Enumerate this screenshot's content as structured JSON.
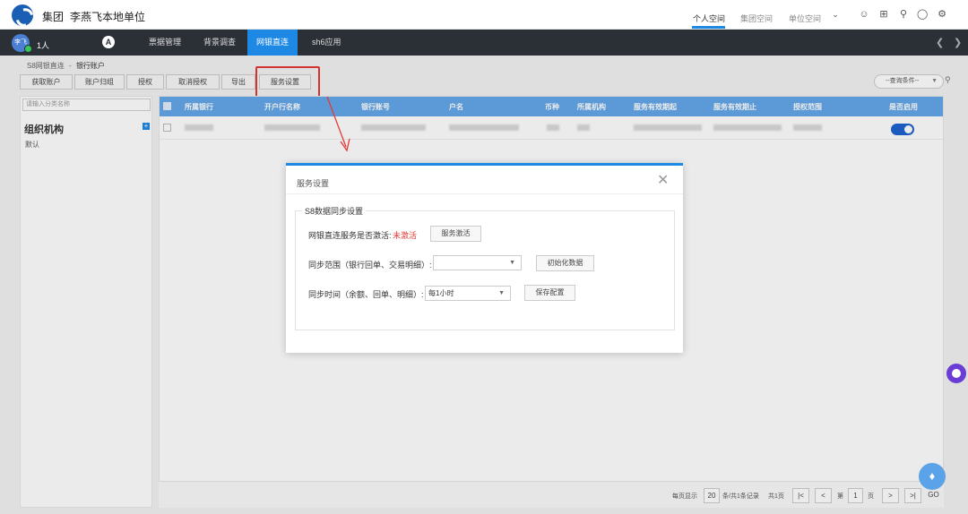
{
  "header": {
    "org": "集团",
    "unit": "李燕飞本地单位",
    "tabs": [
      "个人空间",
      "集团空间",
      "单位空间"
    ],
    "icons": [
      "user-icon",
      "apps-icon",
      "search-icon",
      "chat-icon",
      "settings-icon"
    ]
  },
  "nav": {
    "avatar_text": "李飞",
    "user_count": "1人",
    "items": [
      "票据管理",
      "背景调查",
      "网银直连",
      "sh6应用"
    ],
    "active_index": 2
  },
  "breadcrumb": {
    "parent": "S8网银直连",
    "separator": "-",
    "current": "银行账户"
  },
  "toolbar": {
    "buttons": [
      "获取账户",
      "账户归组",
      "授权",
      "取消授权",
      "导出",
      "服务设置"
    ],
    "query_placeholder": "--查询条件--"
  },
  "left_panel": {
    "search_placeholder": "请输入分类名称",
    "title": "组织机构",
    "items": [
      "默认"
    ]
  },
  "table": {
    "headers": [
      "所属银行",
      "开户行名称",
      "银行账号",
      "户名",
      "币种",
      "所属机构",
      "服务有效期起",
      "服务有效期止",
      "授权范围",
      "是否启用"
    ]
  },
  "pagination": {
    "per_page_label": "每页显示",
    "per_page": "20",
    "summary": "条/共1条记录",
    "pages_total": "共1页",
    "page_prefix": "第",
    "page": "1",
    "page_suffix": "页",
    "go": "GO",
    "first": "|<",
    "prev": "<",
    "next": ">",
    "last": ">|"
  },
  "dialog": {
    "title": "服务设置",
    "section_title": "S8数据同步设置",
    "row1_label": "网银直连服务是否激活:",
    "row1_status": "未激活",
    "row1_button": "服务激活",
    "row2_label": "同步范围（银行回单、交易明细）:",
    "row2_value": "",
    "row2_button": "初始化数据",
    "row3_label": "同步时间（余额、回单、明细）:",
    "row3_value": "每1小时",
    "row3_button": "保存配置"
  },
  "colors": {
    "accent": "#1e88e5",
    "nav_bg": "#2b2f36",
    "status_red": "#e53935",
    "toggle_on": "#1e62d0"
  }
}
